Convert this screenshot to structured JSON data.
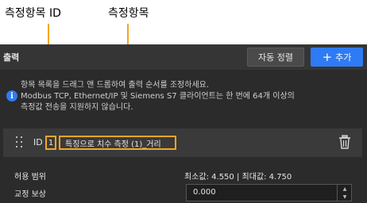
{
  "callouts": {
    "id_label": "측정항목 ID",
    "name_label": "측정항목"
  },
  "header": {
    "title": "출력",
    "sort_button": "자동 정렬",
    "add_button": "추가",
    "add_icon": "plus-icon"
  },
  "info": {
    "icon": "info-icon",
    "lines": [
      "항목 목록을 드래그 앤 드롭하여 출력 순서를 조정하세요.",
      "Modbus TCP, Ethernet/IP 및 Siemens S7 클라이언트는 한 번에 64개 이상의",
      "측정값 전송을 지원하지 않습니다."
    ]
  },
  "item": {
    "id_label": "ID",
    "id_value": "1",
    "name": "특징으로 치수 측정 (1)_거리",
    "drag_icon": "drag-handle-icon",
    "delete_icon": "trash-icon"
  },
  "fields": {
    "tolerance_label": "허용 범위",
    "tolerance_range": "최소값: 4.550 | 최대값: 4.750",
    "offset_label": "교정 보상",
    "offset_value": "0.000"
  },
  "colors": {
    "panel_bg": "#2b2b2b",
    "accent_blue": "#2f7bf5",
    "callout_orange": "#f5a623"
  }
}
